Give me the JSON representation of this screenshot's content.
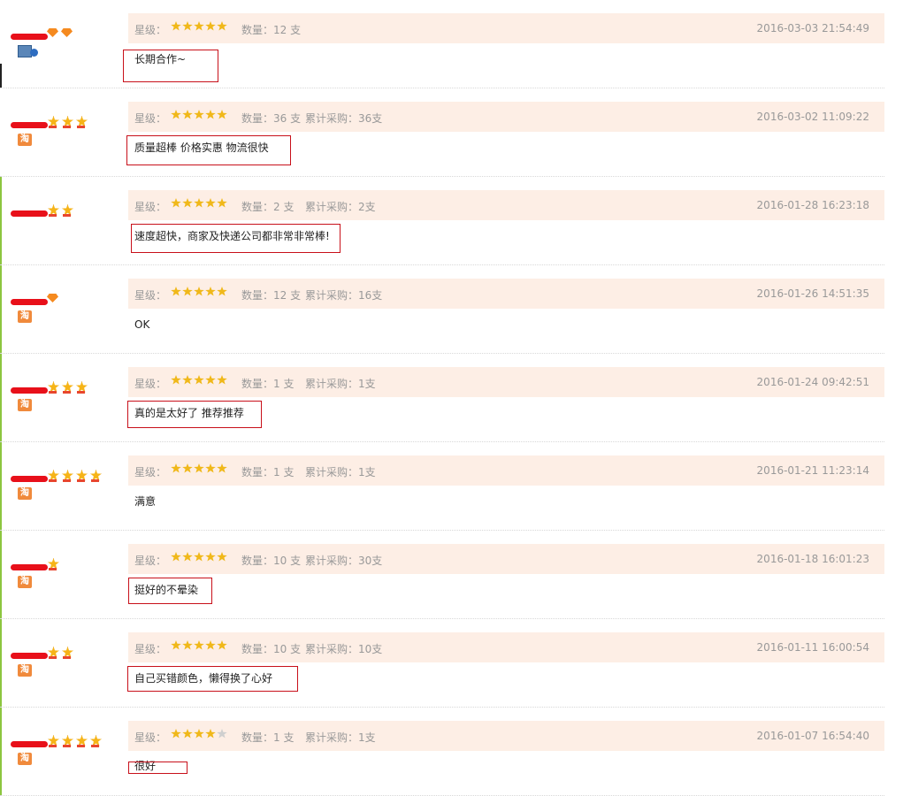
{
  "labels": {
    "star_level": "星级：",
    "quantity": "数量：",
    "cumulative": "累计采购："
  },
  "colors": {
    "meta_background": "#fdeee5",
    "highlight_box": "#c8101a",
    "redaction": "#e8101a",
    "left_edge": "#8cc63f"
  },
  "reviews": [
    {
      "rating": 5,
      "quantity": "12 支",
      "cumulative": "",
      "date": "2016-03-03 21:54:49",
      "comment": "长期合作~",
      "badges": [
        "diamond-icon",
        "diamond-icon"
      ],
      "badge_icon": "verified-avatar-icon",
      "highlighted": true
    },
    {
      "rating": 5,
      "quantity": "36 支",
      "cumulative": "36支",
      "date": "2016-03-02 11:09:22",
      "comment": "质量超棒 价格实惠 物流很快",
      "badges": [
        "crown-icon",
        "crown-icon",
        "crown-icon"
      ],
      "badge_icon": "taobao-icon",
      "highlighted": true
    },
    {
      "rating": 5,
      "quantity": "2 支",
      "cumulative": "2支",
      "date": "2016-01-28 16:23:18",
      "comment": "速度超快，商家及快递公司都非常非常棒!",
      "badges": [
        "crown-icon",
        "crown-icon"
      ],
      "badge_icon": "",
      "highlighted": true
    },
    {
      "rating": 5,
      "quantity": "12 支",
      "cumulative": "16支",
      "date": "2016-01-26 14:51:35",
      "comment": "OK",
      "badges": [
        "diamond-icon"
      ],
      "badge_icon": "taobao-icon",
      "highlighted": false
    },
    {
      "rating": 5,
      "quantity": "1 支",
      "cumulative": "1支",
      "date": "2016-01-24 09:42:51",
      "comment": "真的是太好了 推荐推荐",
      "badges": [
        "crown-icon",
        "crown-icon",
        "crown-icon"
      ],
      "badge_icon": "taobao-icon",
      "highlighted": true
    },
    {
      "rating": 5,
      "quantity": "1 支",
      "cumulative": "1支",
      "date": "2016-01-21 11:23:14",
      "comment": "满意",
      "badges": [
        "crown-icon",
        "crown-icon",
        "crown-icon",
        "crown-icon"
      ],
      "badge_icon": "taobao-icon",
      "highlighted": false
    },
    {
      "rating": 5,
      "quantity": "10 支",
      "cumulative": "30支",
      "date": "2016-01-18 16:01:23",
      "comment": "挺好的不晕染",
      "badges": [
        "crown-icon"
      ],
      "badge_icon": "taobao-icon",
      "highlighted": true
    },
    {
      "rating": 5,
      "quantity": "10 支",
      "cumulative": "10支",
      "date": "2016-01-11 16:00:54",
      "comment": "自己买错颜色，懒得换了心好",
      "badges": [
        "crown-icon",
        "crown-icon"
      ],
      "badge_icon": "taobao-icon",
      "highlighted": true
    },
    {
      "rating": 4,
      "quantity": "1 支",
      "cumulative": "1支",
      "date": "2016-01-07 16:54:40",
      "comment": "很好",
      "badges": [
        "crown-icon",
        "crown-icon",
        "crown-icon",
        "crown-icon"
      ],
      "badge_icon": "taobao-icon",
      "highlighted": true
    }
  ]
}
